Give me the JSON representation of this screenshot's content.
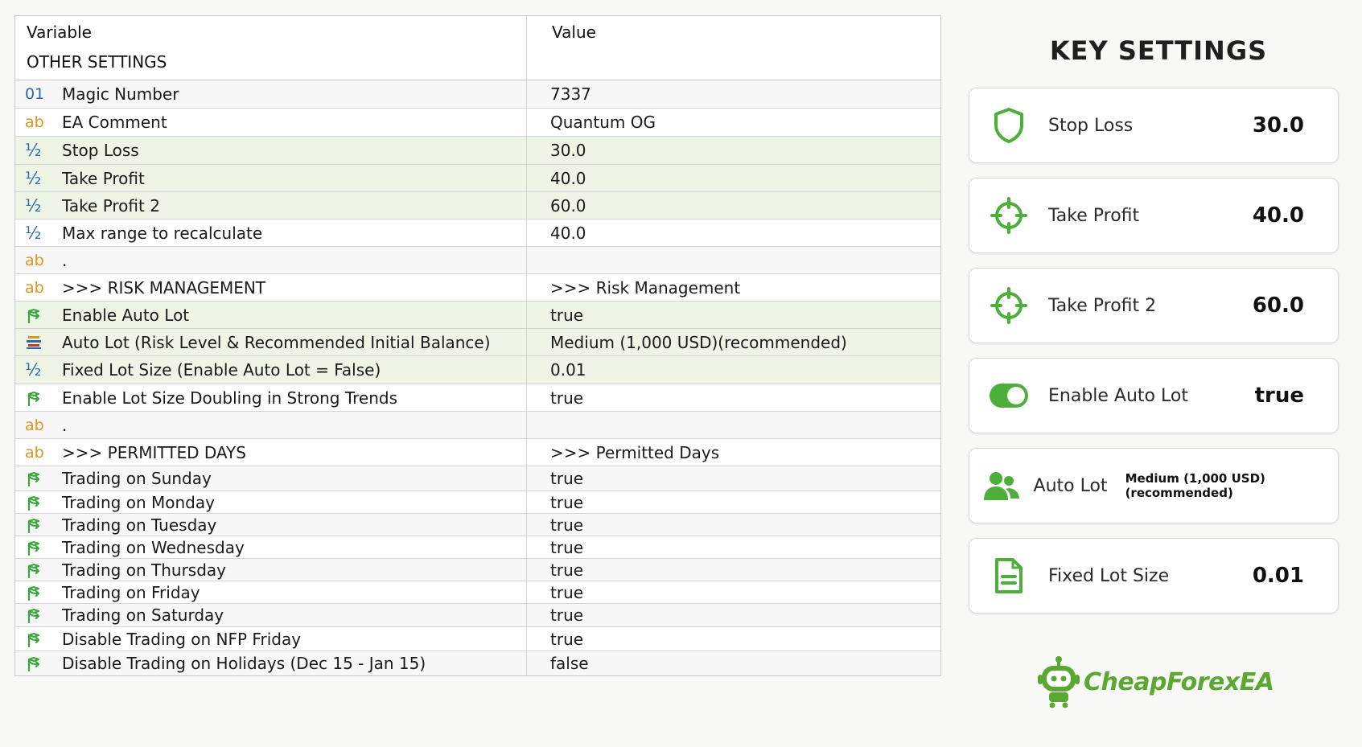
{
  "table": {
    "header": {
      "variable": "Variable",
      "value": "Value",
      "section": "OTHER SETTINGS"
    },
    "rows": [
      {
        "icon": "01",
        "type": "int",
        "label": "Magic Number",
        "value": "7337",
        "shade": "s"
      },
      {
        "icon": "ab",
        "type": "string",
        "label": "EA Comment",
        "value": "Quantum OG",
        "shade": ""
      },
      {
        "icon": "½",
        "type": "double",
        "label": "Stop Loss",
        "value": "30.0",
        "shade": "g"
      },
      {
        "icon": "½",
        "type": "double",
        "label": "Take Profit",
        "value": "40.0",
        "shade": "g"
      },
      {
        "icon": "½",
        "type": "double",
        "label": "Take Profit 2",
        "value": "60.0",
        "shade": "g"
      },
      {
        "icon": "½",
        "type": "double",
        "label": "Max range to recalculate",
        "value": "40.0",
        "shade": ""
      },
      {
        "icon": "ab",
        "type": "string",
        "label": ".",
        "value": "",
        "shade": "s"
      },
      {
        "icon": "ab",
        "type": "string",
        "label": ">>> RISK MANAGEMENT",
        "value": ">>> Risk Management",
        "shade": ""
      },
      {
        "icon": "bool",
        "type": "bool",
        "label": "Enable Auto Lot",
        "value": "true",
        "shade": "g"
      },
      {
        "icon": "enum",
        "type": "enum",
        "label": "Auto Lot (Risk Level & Recommended Initial Balance)",
        "value": "Medium (1,000 USD)(recommended)",
        "shade": "g"
      },
      {
        "icon": "½",
        "type": "double",
        "label": "Fixed Lot Size (Enable Auto Lot = False)",
        "value": "0.01",
        "shade": "g"
      },
      {
        "icon": "bool",
        "type": "bool",
        "label": "Enable Lot Size Doubling in Strong Trends",
        "value": "true",
        "shade": ""
      },
      {
        "icon": "ab",
        "type": "string",
        "label": ".",
        "value": "",
        "shade": "s"
      },
      {
        "icon": "ab",
        "type": "string",
        "label": ">>> PERMITTED DAYS",
        "value": ">>> Permitted Days",
        "shade": ""
      },
      {
        "icon": "bool",
        "type": "bool",
        "label": "Trading on Sunday",
        "value": "true",
        "shade": "s"
      },
      {
        "icon": "bool",
        "type": "bool",
        "label": "Trading on Monday",
        "value": "true",
        "shade": ""
      },
      {
        "icon": "bool",
        "type": "bool",
        "label": "Trading on Tuesday",
        "value": "true",
        "shade": "s"
      },
      {
        "icon": "bool",
        "type": "bool",
        "label": "Trading on Wednesday",
        "value": "true",
        "shade": ""
      },
      {
        "icon": "bool",
        "type": "bool",
        "label": "Trading on Thursday",
        "value": "true",
        "shade": "s"
      },
      {
        "icon": "bool",
        "type": "bool",
        "label": "Trading on Friday",
        "value": "true",
        "shade": ""
      },
      {
        "icon": "bool",
        "type": "bool",
        "label": "Trading on Saturday",
        "value": "true",
        "shade": "s"
      },
      {
        "icon": "bool",
        "type": "bool",
        "label": "Disable Trading on NFP Friday",
        "value": "true",
        "shade": ""
      },
      {
        "icon": "bool",
        "type": "bool",
        "label": "Disable Trading on Holidays (Dec 15 - Jan 15)",
        "value": "false",
        "shade": "s"
      }
    ]
  },
  "key_settings": {
    "title": "KEY SETTINGS",
    "cards": [
      {
        "icon": "shield-icon",
        "label": "Stop Loss",
        "value": "30.0"
      },
      {
        "icon": "crosshair-icon",
        "label": "Take Profit",
        "value": "40.0"
      },
      {
        "icon": "crosshair-icon",
        "label": "Take Profit 2",
        "value": "60.0"
      },
      {
        "icon": "toggle-icon",
        "label": "Enable Auto Lot",
        "value": "true"
      },
      {
        "icon": "users-icon",
        "label": "Auto Lot",
        "value": "Medium (1,000 USD)(recommended)"
      },
      {
        "icon": "document-icon",
        "label": "Fixed Lot Size",
        "value": "0.01"
      }
    ]
  },
  "brand": {
    "name": "CheapForexEA",
    "color": "#5aa832"
  },
  "colors": {
    "accent_green": "#4caf3a",
    "row_green": "#eef5e6",
    "int_icon_blue": "#2b6aa8",
    "string_icon_orange": "#d9961a"
  }
}
